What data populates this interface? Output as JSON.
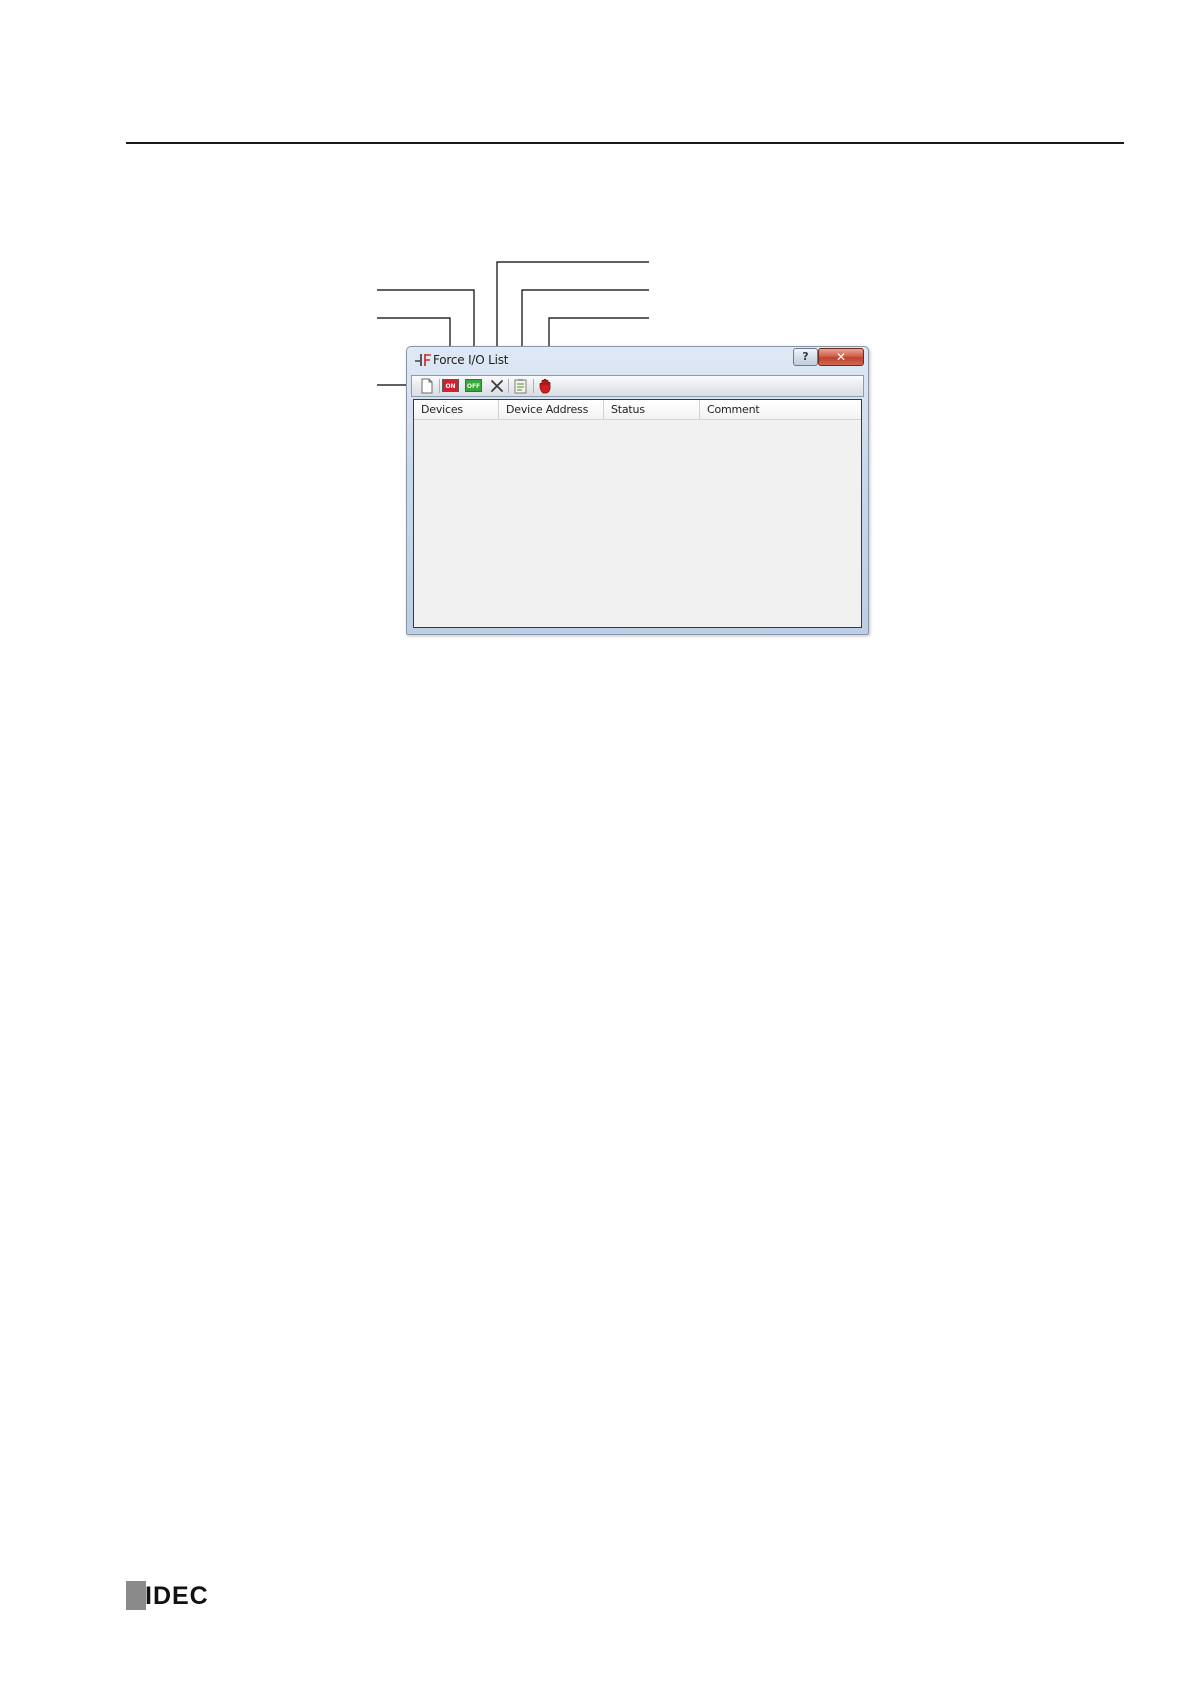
{
  "dialog": {
    "title": "Force I/O List",
    "help_glyph": "?",
    "close_glyph": "✕",
    "icons": {
      "app": "force-io-app-icon",
      "help": "help-icon",
      "close": "close-icon"
    }
  },
  "toolbar": {
    "buttons": [
      {
        "name": "new-icon",
        "label": ""
      },
      {
        "name": "force-on-icon",
        "label": "ON",
        "color": "#d31f2e"
      },
      {
        "name": "force-off-icon",
        "label": "OFF",
        "color": "#37a93a"
      },
      {
        "name": "delete-icon",
        "label": ""
      },
      {
        "name": "list-icon",
        "label": ""
      },
      {
        "name": "stop-hand-icon",
        "label": "",
        "color": "#d11f1f"
      }
    ]
  },
  "table": {
    "columns": [
      "Devices",
      "Device Address",
      "Status",
      "Comment"
    ],
    "rows": []
  },
  "footer": {
    "logo_text": "IDEC"
  }
}
